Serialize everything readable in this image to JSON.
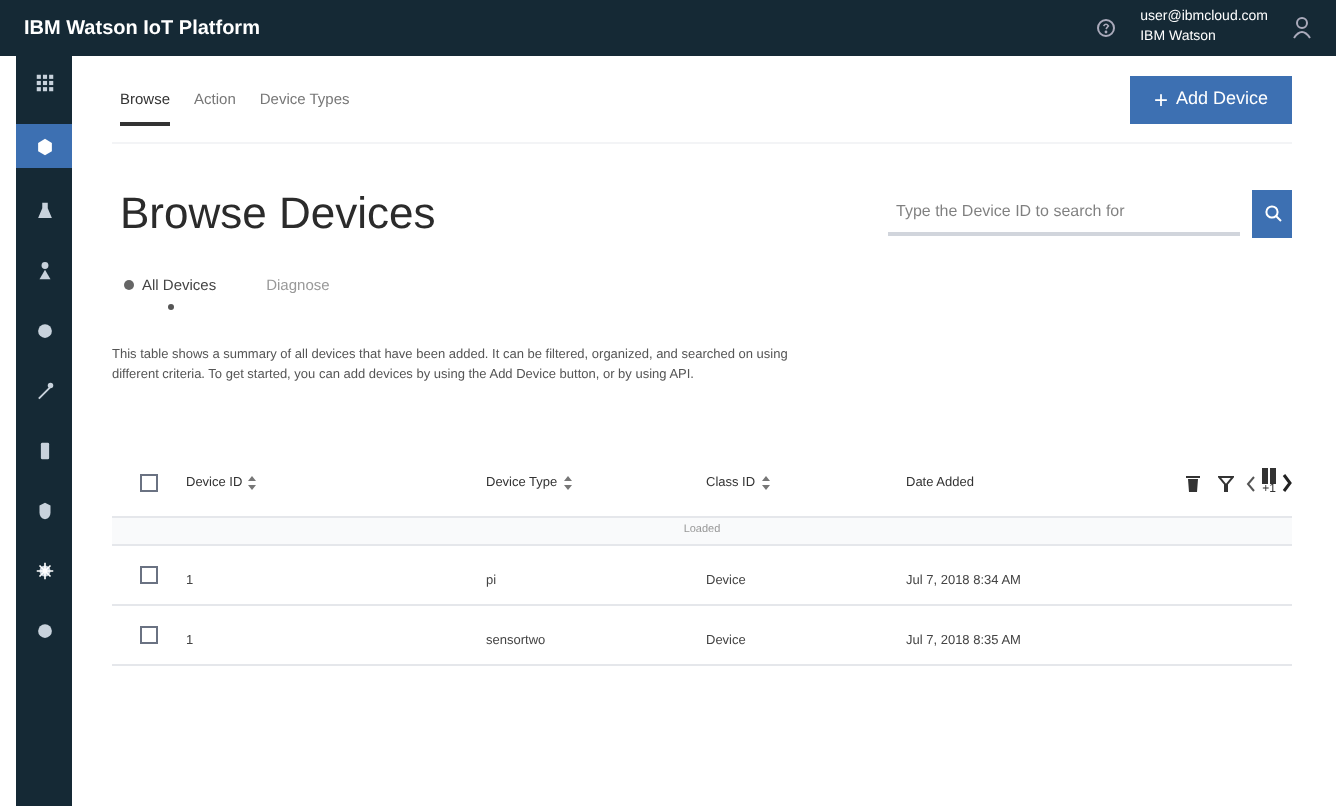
{
  "header": {
    "title": "IBM Watson IoT Platform",
    "user_email": "user@ibmcloud.com",
    "user_org": "IBM Watson"
  },
  "sidebar": {
    "items": [
      {
        "kind": "grid",
        "selected": false
      },
      {
        "kind": "devices",
        "selected": true
      },
      {
        "kind": "rules",
        "selected": false
      },
      {
        "kind": "members",
        "selected": false
      },
      {
        "kind": "apps",
        "selected": false
      },
      {
        "kind": "tools",
        "selected": false
      },
      {
        "kind": "storage",
        "selected": false
      },
      {
        "kind": "security",
        "selected": false
      },
      {
        "kind": "settings",
        "selected": false
      },
      {
        "kind": "extensions",
        "selected": false
      }
    ]
  },
  "tabs": [
    {
      "label": "Browse",
      "selected": true
    },
    {
      "label": "Action",
      "selected": false
    },
    {
      "label": "Device Types",
      "selected": false
    }
  ],
  "add_button": {
    "icon": "+",
    "label": "Add Device"
  },
  "page_title": "Browse Devices",
  "view_switch": [
    {
      "label": "All Devices",
      "selected": true
    },
    {
      "label": "Diagnose",
      "selected": false
    }
  ],
  "search": {
    "placeholder": "Type the Device ID to search for"
  },
  "description": "This table shows a summary of all devices that have been added. It can be filtered, organized, and searched on using different criteria. To get started, you can add devices by using the Add Device button, or by using API.",
  "table": {
    "columns": [
      "Device ID",
      "Device Type",
      "Class ID",
      "Date Added"
    ],
    "select_all": {
      "checked": false
    },
    "column_count_badge": "+1",
    "group_label": "Loaded",
    "rows": [
      {
        "cells": [
          "1",
          "pi",
          "Device",
          "Jul 7, 2018 8:34 AM"
        ],
        "checked": false
      },
      {
        "cells": [
          "1",
          "sensortwo",
          "Device",
          "Jul 7, 2018 8:35 AM"
        ],
        "checked": false
      }
    ]
  }
}
